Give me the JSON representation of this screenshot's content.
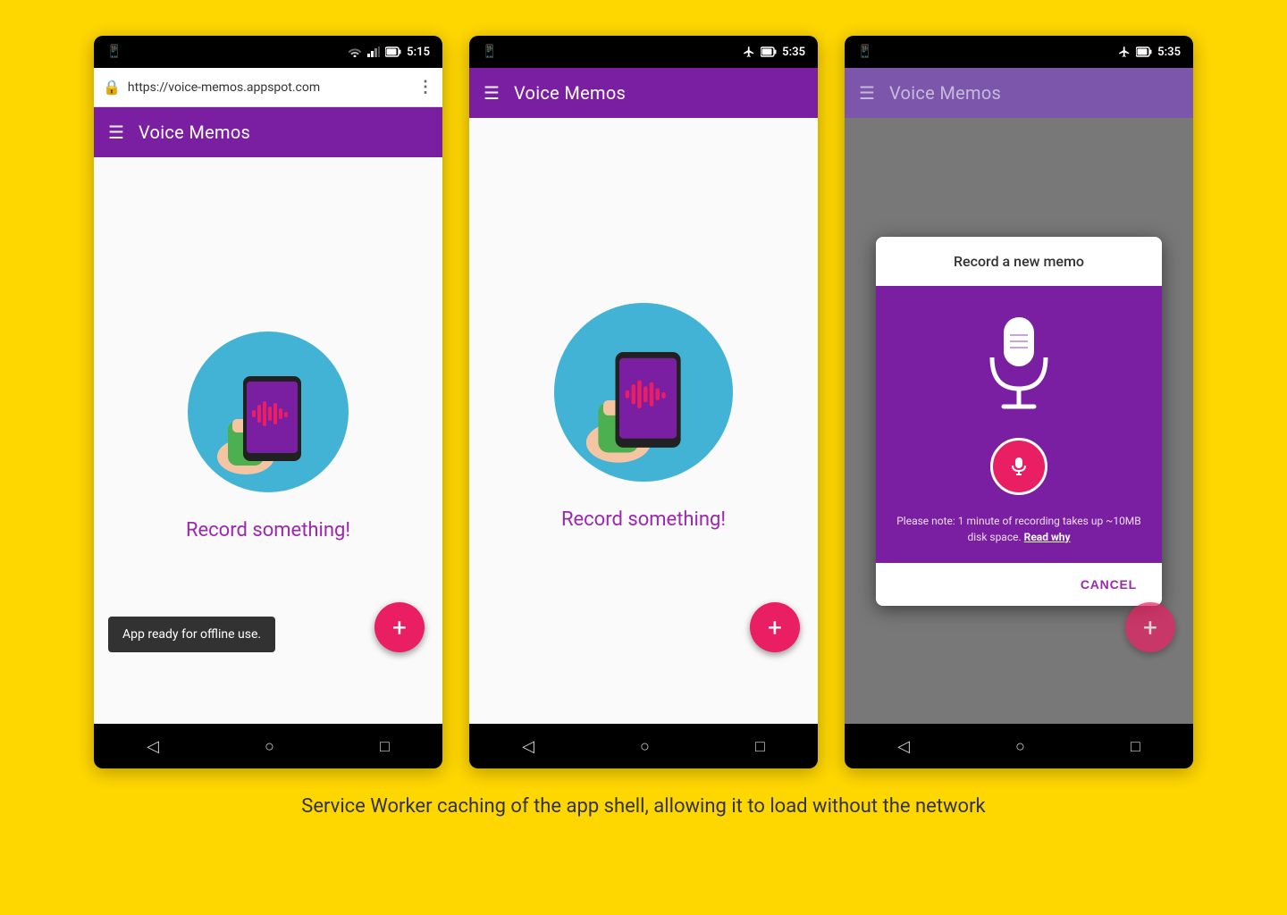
{
  "background_color": "#FFD700",
  "caption": "Service Worker caching of the app shell, allowing it to load without the network",
  "phone1": {
    "status_bar": {
      "time": "5:15",
      "icons": [
        "wifi",
        "signal",
        "battery"
      ]
    },
    "url_bar": {
      "url": "https://voice-memos.appspot.com",
      "has_lock": true
    },
    "toolbar": {
      "title": "Voice Memos"
    },
    "content": {
      "label": "Record something!",
      "snackbar": "App ready for offline use."
    },
    "fab": "+",
    "nav_icons": [
      "back",
      "home",
      "square"
    ]
  },
  "phone2": {
    "status_bar": {
      "time": "5:35",
      "icons": [
        "airplane",
        "battery"
      ]
    },
    "toolbar": {
      "title": "Voice Memos"
    },
    "content": {
      "label": "Record something!"
    },
    "fab": "+",
    "nav_icons": [
      "back",
      "home",
      "square"
    ]
  },
  "phone3": {
    "status_bar": {
      "time": "5:35",
      "icons": [
        "airplane",
        "battery"
      ]
    },
    "toolbar": {
      "title": "Voice Memos"
    },
    "dialog": {
      "title": "Record a new memo",
      "note": "Please note: 1 minute of recording takes up ~10MB disk space.",
      "note_link": "Read why",
      "cancel_btn": "CANCEL"
    },
    "fab": "+",
    "nav_icons": [
      "back",
      "home",
      "square"
    ]
  }
}
